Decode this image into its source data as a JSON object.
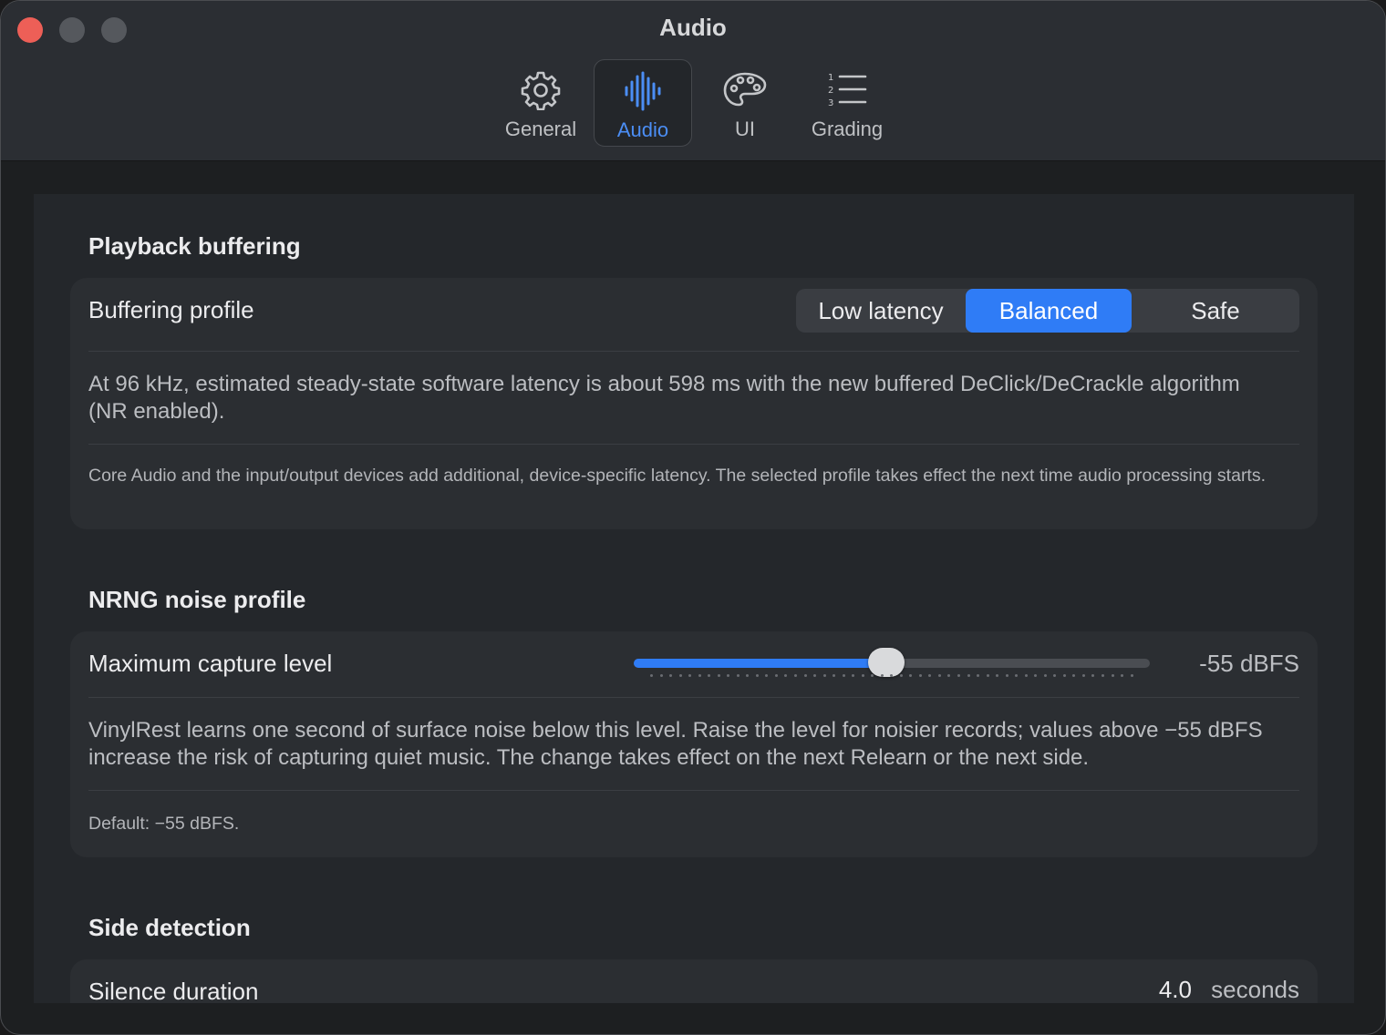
{
  "window": {
    "title": "Audio"
  },
  "toolbar": {
    "tabs": [
      {
        "label": "General",
        "icon": "gear-icon"
      },
      {
        "label": "Audio",
        "icon": "waveform-icon",
        "active": true
      },
      {
        "label": "UI",
        "icon": "palette-icon"
      },
      {
        "label": "Grading",
        "icon": "numbered-list-icon"
      }
    ]
  },
  "playback": {
    "section_title": "Playback buffering",
    "profile_label": "Buffering profile",
    "options": [
      "Low latency",
      "Balanced",
      "Safe"
    ],
    "selected": "Balanced",
    "latency_note": "At 96 kHz, estimated steady-state software latency is about 598 ms with the new buffered DeClick/DeCrackle algorithm (NR enabled).",
    "device_note": "Core Audio and the input/output devices add additional, device-specific latency. The selected profile takes effect the next time audio processing starts."
  },
  "noise": {
    "section_title": "NRNG noise profile",
    "capture_label": "Maximum capture level",
    "slider_fraction": 0.49,
    "value_text": "-55 dBFS",
    "description": "VinylRest learns one second of surface noise below this level. Raise the level for noisier records; values above −55 dBFS increase the risk of capturing quiet music. The change takes effect on the next Relearn or the next side.",
    "default_note": "Default: −55 dBFS."
  },
  "side_detection": {
    "section_title": "Side detection",
    "silence_label": "Silence duration",
    "silence_value": "4.0",
    "silence_unit": "seconds"
  },
  "colors": {
    "accent": "#2f7cf6",
    "close": "#ed5f57",
    "background": "#24272b",
    "card": "#2b2e32"
  }
}
